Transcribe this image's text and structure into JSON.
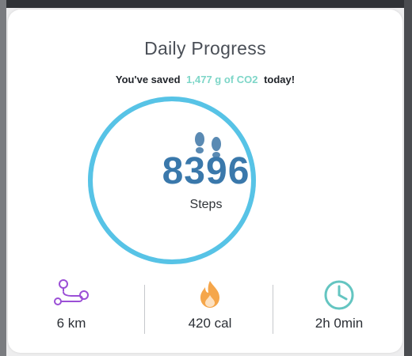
{
  "card": {
    "title": "Daily Progress",
    "saved_prefix": "You've saved",
    "saved_amount": "1,477 g of CO2",
    "saved_suffix": "today!"
  },
  "steps": {
    "value": "8396",
    "label": "Steps",
    "ring_color": "#57c3e6",
    "icon": "footsteps-icon"
  },
  "stats": [
    {
      "icon": "route-icon",
      "value": "6 km",
      "color": "#9b4fd6"
    },
    {
      "icon": "flame-icon",
      "value": "420 cal",
      "color": "#f5a64a"
    },
    {
      "icon": "clock-icon",
      "value": "2h 0min",
      "color": "#64c5c1"
    }
  ],
  "colors": {
    "title": "#4a4f57",
    "steps_value": "#3a78ab",
    "highlight": "#7ed6c8"
  }
}
